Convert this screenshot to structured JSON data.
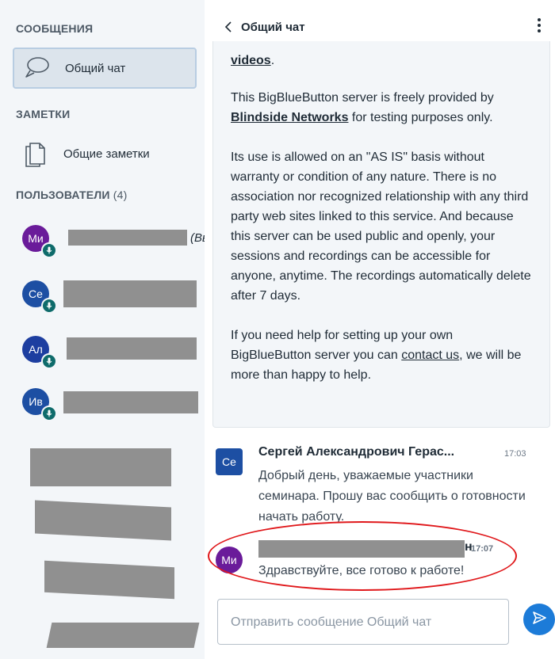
{
  "sidebar": {
    "messages_title": "СООБЩЕНИЯ",
    "public_chat_label": "Общий чат",
    "notes_title": "ЗАМЕТКИ",
    "shared_notes_label": "Общие заметки",
    "users_title": "ПОЛЬЗОВАТЕЛИ",
    "users_count": "(4)",
    "users": [
      {
        "initials": "Ми",
        "color": "#6a1b9a",
        "you_label": "(Вы)"
      },
      {
        "initials": "Се",
        "color": "#1d4fa3"
      },
      {
        "initials": "Ал",
        "color": "#1d3ea0"
      },
      {
        "initials": "Ив",
        "color": "#1d4fa3"
      }
    ]
  },
  "chat": {
    "title": "Общий чат",
    "welcome": {
      "line0_link": "videos",
      "line0_tail": ".",
      "p1_a": "This BigBlueButton server is freely provided by ",
      "p1_link": "Blindside Networks",
      "p1_b": " for testing purposes only.",
      "p2": "Its use is allowed on an \"AS IS\" basis without warranty or condition of any nature. There is no association nor recognized relationship with any third party web sites linked to this service. And because this server can be used public and openly, your sessions and recordings can be accessible for anyone, anytime. The recordings automatically delete after 7 days.",
      "p3_a": "If you need help for setting up your own BigBlueButton server you can ",
      "p3_link": "contact us",
      "p3_b": ", we will be more than happy to help."
    },
    "messages": [
      {
        "initials": "Се",
        "color": "#1d4fa3",
        "name": "Сергей Александрович Герас...",
        "time": "17:03",
        "text": "Добрый день, уважаемые участники семинара. Прошу вас сообщить о готовности начать работу."
      },
      {
        "initials": "Ми",
        "color": "#6a1b9a",
        "name_visible_tail": "н",
        "time": "17:07",
        "text": "Здравствуйте, все готово к работе!"
      }
    ],
    "composer_placeholder": "Отправить сообщение Общий чат"
  },
  "icons": {
    "chat": "chat-bubble-icon",
    "notes": "document-icon",
    "mic": "microphone-icon",
    "back": "chevron-left-icon",
    "menu": "vertical-dots-icon",
    "send": "send-icon"
  }
}
